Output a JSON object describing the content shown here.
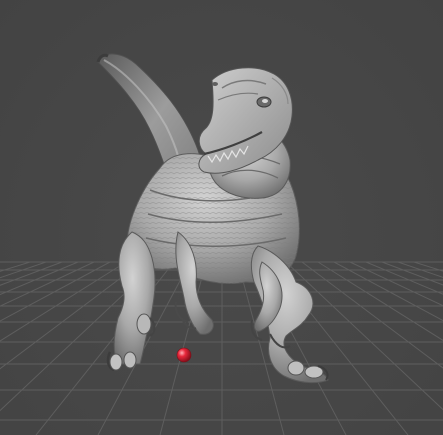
{
  "viewport": {
    "background_color": "#474747",
    "grid_color": "#5e5e5e",
    "mesh_color": "#b3b3b3",
    "mesh_shadow_color": "#5a5a5a",
    "marker_color": "#e8273b"
  },
  "scene": {
    "model": "velociraptor-sculpt-mesh",
    "grid": true,
    "marker": "red-sphere-pivot"
  }
}
